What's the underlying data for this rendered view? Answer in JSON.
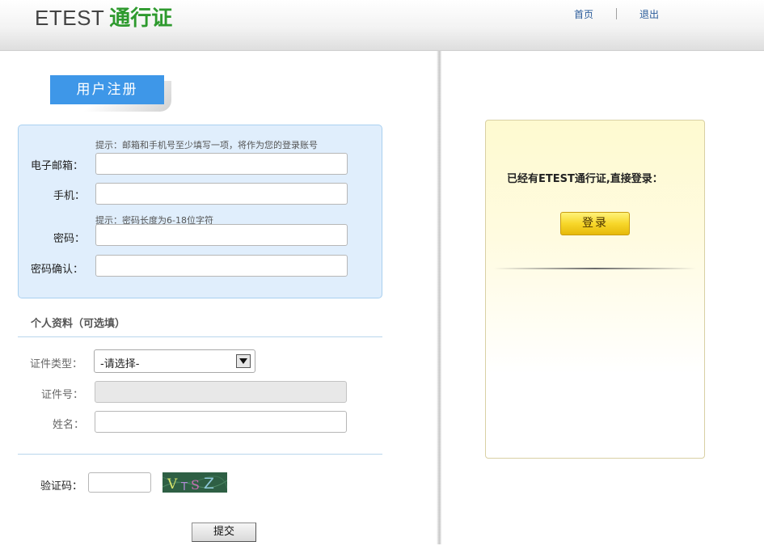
{
  "header": {
    "brand": "ETEST",
    "brand_suffix": "通行证",
    "nav_home": "首页",
    "nav_logout": "退出"
  },
  "register": {
    "title": "用户注册",
    "hint_contact": "提示：邮箱和手机号至少填写一项，将作为您的登录账号",
    "email_label": "电子邮箱：",
    "email_value": "",
    "phone_label": "手机：",
    "phone_value": "",
    "hint_password": "提示：密码长度为6-18位字符",
    "password_label": "密码：",
    "password_value": "",
    "confirm_label": "密码确认：",
    "confirm_value": ""
  },
  "profile": {
    "title": "个人资料（可选填）",
    "id_type_label": "证件类型：",
    "id_type_selected": "-请选择-",
    "id_number_label": "证件号：",
    "id_number_value": "",
    "name_label": "姓名：",
    "name_value": ""
  },
  "captcha": {
    "label": "验证码：",
    "value": "",
    "image_text": "VTSZ"
  },
  "submit_label": "提交",
  "login": {
    "prompt": "已经有ETEST通行证,直接登录：",
    "button_label": "登录"
  }
}
